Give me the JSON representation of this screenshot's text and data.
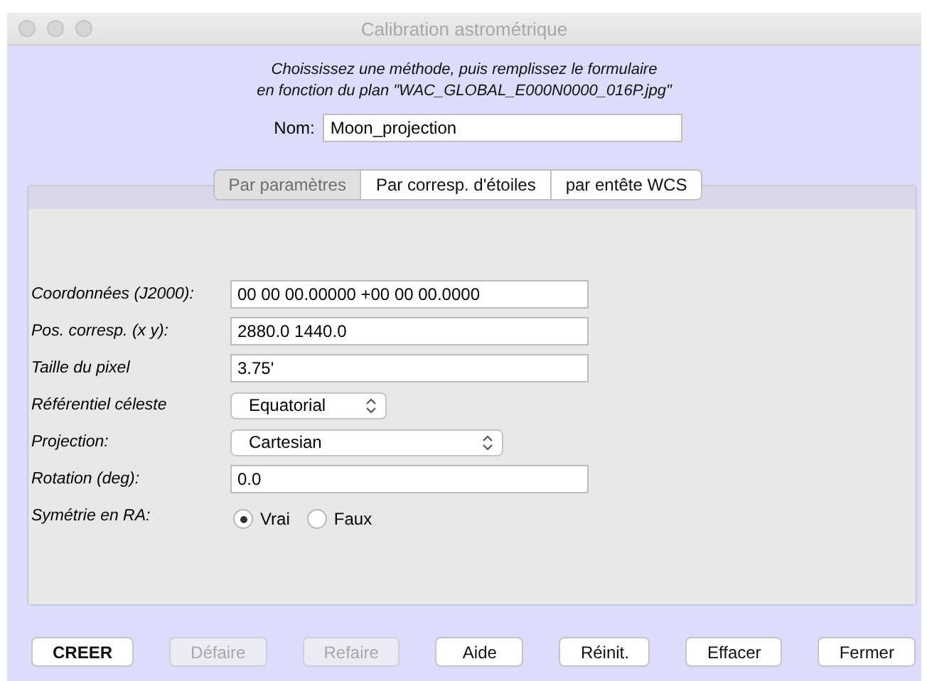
{
  "window": {
    "title": "Calibration astrométrique"
  },
  "instructions": [
    "Choississez une méthode, puis remplissez le formulaire",
    "en fonction du plan \"WAC_GLOBAL_E000N0000_016P.jpg\""
  ],
  "name_field": {
    "label": "Nom:",
    "value": "Moon_projection"
  },
  "tabs": [
    {
      "label": "Par paramètres",
      "selected": true
    },
    {
      "label": "Par corresp. d'étoiles",
      "selected": false
    },
    {
      "label": "par entête WCS",
      "selected": false
    }
  ],
  "fields": [
    {
      "kind": "text",
      "label": "Coordonnées (J2000):",
      "value": "00 00 00.00000 +00 00 00.0000"
    },
    {
      "kind": "text",
      "label": "Pos. corresp. (x y):",
      "value": "2880.0 1440.0"
    },
    {
      "kind": "text",
      "label": "Taille du pixel",
      "value": "3.75'"
    },
    {
      "kind": "select",
      "label": "Référentiel céleste",
      "value": "Equatorial"
    },
    {
      "kind": "select-wide",
      "label": "Projection:",
      "value": "Cartesian"
    },
    {
      "kind": "text",
      "label": "Rotation (deg):",
      "value": "0.0"
    },
    {
      "kind": "radio",
      "label": "Symétrie en RA:",
      "options": [
        {
          "label": "Vrai",
          "selected": true
        },
        {
          "label": "Faux",
          "selected": false
        }
      ]
    }
  ],
  "buttons": [
    {
      "label": "CREER",
      "disabled": false,
      "default": true
    },
    {
      "label": "Défaire",
      "disabled": true,
      "default": false
    },
    {
      "label": "Refaire",
      "disabled": true,
      "default": false
    },
    {
      "label": "Aide",
      "disabled": false,
      "default": false
    },
    {
      "label": "Réinit.",
      "disabled": false,
      "default": false
    },
    {
      "label": "Effacer",
      "disabled": false,
      "default": false
    },
    {
      "label": "Fermer",
      "disabled": false,
      "default": false
    }
  ]
}
